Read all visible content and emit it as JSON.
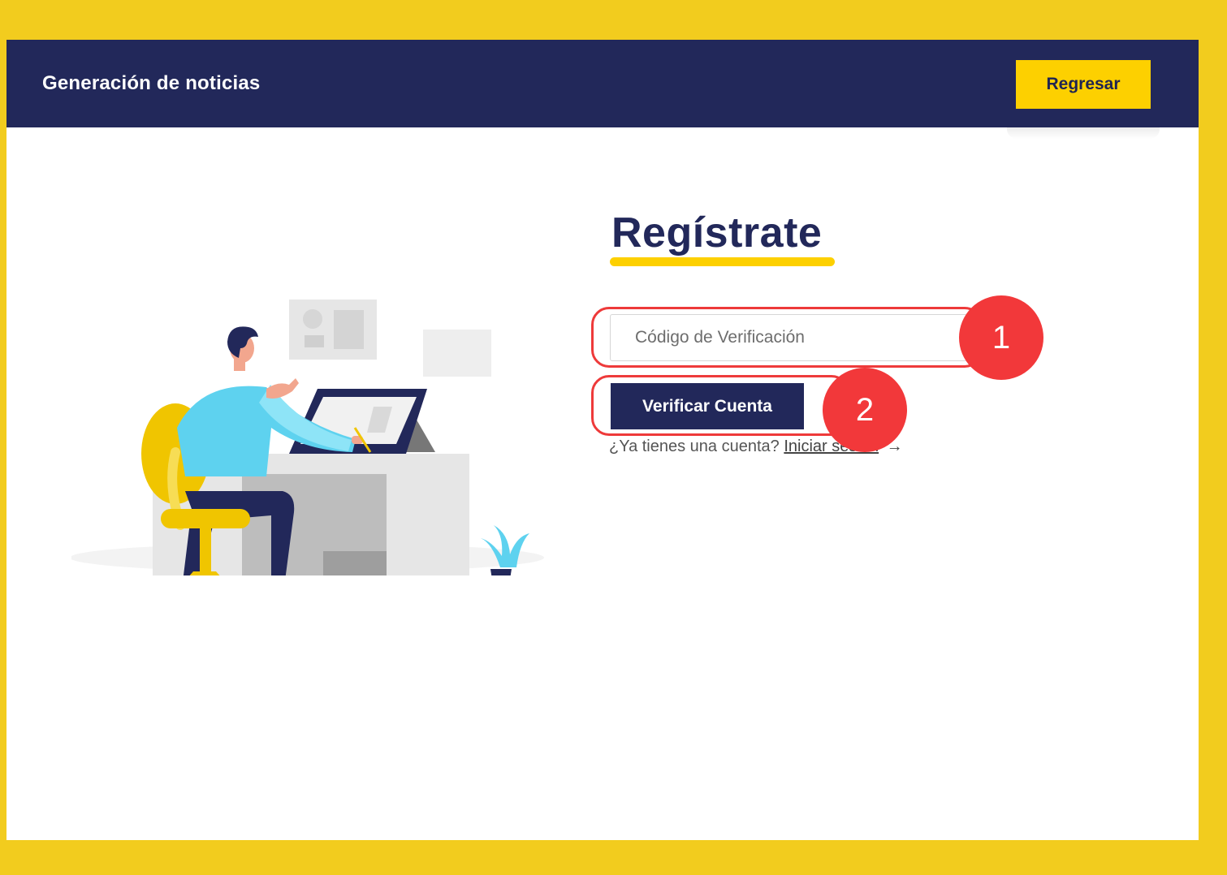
{
  "header": {
    "brand": "Generación de noticias",
    "back_label": "Regresar"
  },
  "form": {
    "title": "Regístrate",
    "code_placeholder": "Código de Verificación",
    "verify_label": "Verificar Cuenta",
    "login_prompt": "¿Ya tienes una cuenta?",
    "login_link": "Iniciar sesión",
    "login_arrow": "→"
  },
  "annotations": {
    "step_1": "1",
    "step_2": "2"
  },
  "colors": {
    "outer_background": "#f2cc1e",
    "navbar": "#22285a",
    "accent_yellow": "#fdd000",
    "highlight_red": "#ee3a3a"
  }
}
